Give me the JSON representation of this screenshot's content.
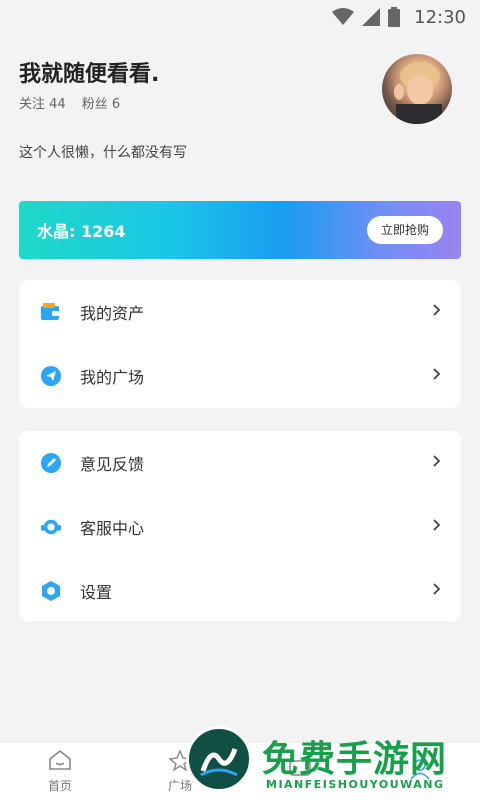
{
  "status_bar": {
    "time": "12:30",
    "icons": [
      "wifi-icon",
      "signal-icon",
      "battery-icon"
    ]
  },
  "profile": {
    "name": "我就随便看看.",
    "following_label": "关注 44",
    "followers_label": "粉丝 6",
    "bio": "这个人很懒，什么都没有写"
  },
  "crystal": {
    "label": "水晶: 1264",
    "button_label": "立即抢购",
    "gradient_colors": [
      "#1fd8c8",
      "#199cf0",
      "#9a83f0"
    ]
  },
  "menu_group_1": [
    {
      "label": "我的资产",
      "icon": "wallet-icon"
    },
    {
      "label": "我的广场",
      "icon": "paper-plane-icon"
    }
  ],
  "menu_group_2": [
    {
      "label": "意见反馈",
      "icon": "pencil-icon"
    },
    {
      "label": "客服中心",
      "icon": "headset-icon"
    },
    {
      "label": "设置",
      "icon": "hexagon-gear-icon"
    }
  ],
  "bottom_nav": [
    {
      "label": "首页",
      "icon": "home-icon"
    },
    {
      "label": "广场",
      "icon": "square-icon"
    },
    {
      "label": "",
      "icon": "message-icon"
    },
    {
      "label": "",
      "icon": "profile-icon"
    }
  ],
  "watermark": {
    "title": "免费手游网",
    "subtitle": "MIANFEISHOUYOUWANG"
  },
  "colors": {
    "accent_blue": "#2aa6f5",
    "watermark_green": "#16a049"
  }
}
